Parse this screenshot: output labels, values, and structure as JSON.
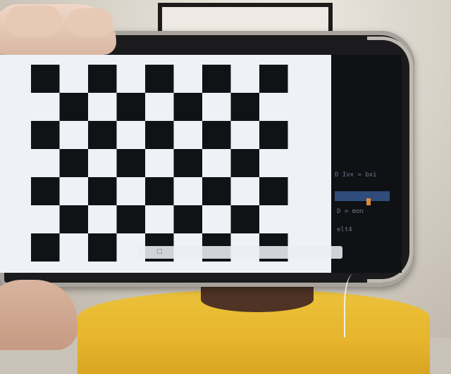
{
  "scene": {
    "board": {
      "rows": 7,
      "cols": 9,
      "dark_color": "#111216",
      "light_color": "#f2f3f7",
      "screen_color": "#eef1f6"
    },
    "panel": {
      "bg_color": "#0f1115",
      "lines": [
        "D Ivx = bxi",
        "D = mon",
        "elt4"
      ],
      "tab_label": "",
      "accent_color": "#2f4c7a"
    },
    "colors": {
      "shirt": "#e6b52c",
      "phone": "#1b1b1d",
      "case": "#a7a39c"
    }
  }
}
